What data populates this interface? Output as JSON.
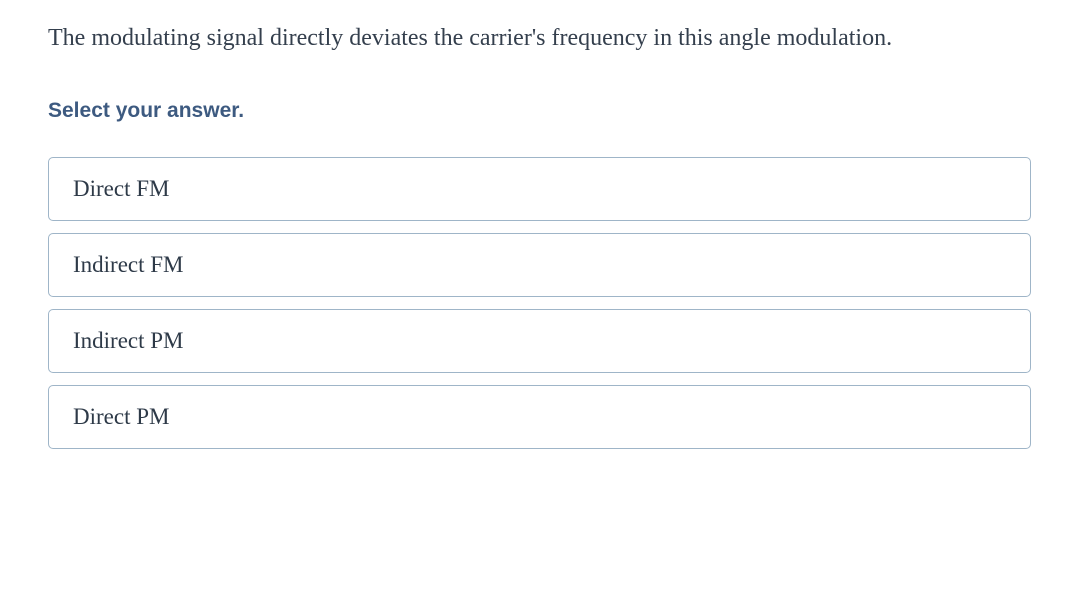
{
  "question": {
    "text": "The modulating signal directly deviates the carrier's frequency in this angle modulation.",
    "prompt": "Select your answer."
  },
  "options": [
    {
      "label": "Direct FM"
    },
    {
      "label": "Indirect FM"
    },
    {
      "label": "Indirect PM"
    },
    {
      "label": "Direct PM"
    }
  ]
}
